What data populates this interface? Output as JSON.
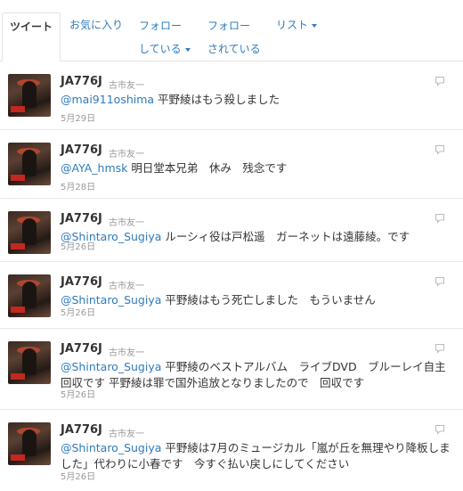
{
  "tabs": [
    {
      "label": "ツイート"
    },
    {
      "label": "お気に入り"
    },
    {
      "label": "フォロー",
      "sub": "している"
    },
    {
      "label": "フォロー",
      "sub": "されている"
    },
    {
      "label": "リスト"
    }
  ],
  "tweets": [
    {
      "screen_name": "JA776J",
      "full_name": "古市友一",
      "mention": "@mai911oshima",
      "text": " 平野綾はもう殺しました",
      "date": "5月29日"
    },
    {
      "screen_name": "JA776J",
      "full_name": "古市友一",
      "mention": "@AYA_hmsk",
      "text": " 明日堂本兄弟　休み　残念です",
      "date": "5月28日"
    },
    {
      "screen_name": "JA776J",
      "full_name": "古市友一",
      "mention": "@Shintaro_Sugiya",
      "text": " ルーシィ役は戸松遥　ガーネットは遠藤綾。です",
      "date": "5月26日"
    },
    {
      "screen_name": "JA776J",
      "full_name": "古市友一",
      "mention": "@Shintaro_Sugiya",
      "text": " 平野綾はもう死亡しました　もういません",
      "date": "5月26日"
    },
    {
      "screen_name": "JA776J",
      "full_name": "古市友一",
      "mention": "@Shintaro_Sugiya",
      "text": " 平野綾のベストアルバム　ライブDVD　ブルーレイ自主回収です 平野綾は罪で国外追放となりましたので　回収です",
      "date": "5月26日"
    },
    {
      "screen_name": "JA776J",
      "full_name": "古市友一",
      "mention": "@Shintaro_Sugiya",
      "text": " 平野綾は7月のミュージカル「嵐が丘を無理やり降板しました」代わりに小春です　今すぐ払い戻しにしてください",
      "date": "5月26日"
    }
  ]
}
